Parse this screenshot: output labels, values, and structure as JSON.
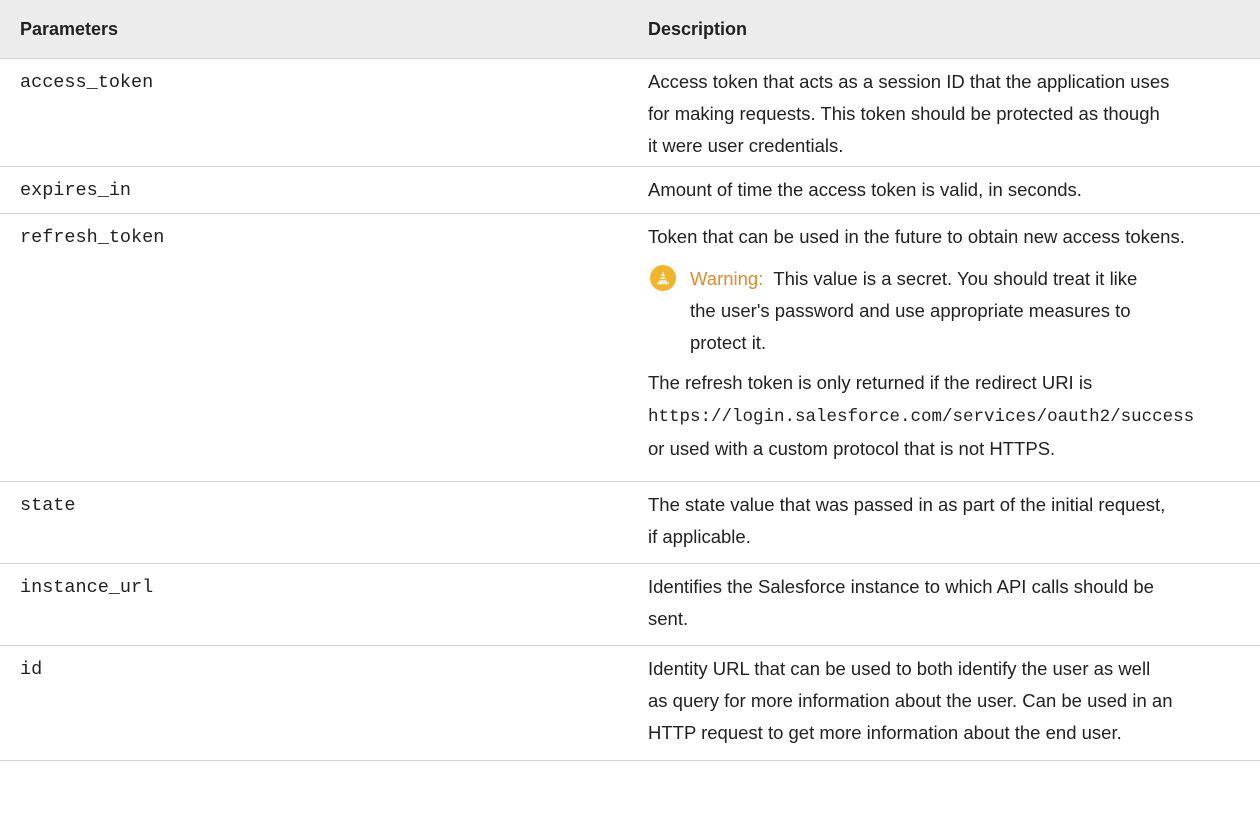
{
  "table": {
    "headers": {
      "parameters": "Parameters",
      "description": "Description"
    },
    "rows": [
      {
        "name": "access_token",
        "lines": [
          "Access token that acts as a session ID that the application uses",
          "for making requests. This token should be protected as though",
          "it were user credentials."
        ]
      },
      {
        "name": "expires_in",
        "lines": [
          "Amount of time the access token is valid, in seconds."
        ]
      },
      {
        "name": "refresh_token",
        "lines": [
          "Token that can be used in the future to obtain new access tokens."
        ],
        "warning": {
          "label": "Warning:",
          "line1": "This value is a secret. You should treat it like",
          "line2": "the user's password and use appropriate measures to",
          "line3": "protect it."
        },
        "after": {
          "line1": "The refresh token is only returned if the redirect URI is",
          "code": "https://login.salesforce.com/services/oauth2/success",
          "line3": "or used with a custom protocol that is not HTTPS."
        }
      },
      {
        "name": "state",
        "lines": [
          "The state value that was passed in as part of the initial request,",
          "if applicable."
        ]
      },
      {
        "name": "instance_url",
        "lines": [
          "Identifies the Salesforce instance to which API calls should be",
          "sent."
        ]
      },
      {
        "name": "id",
        "lines": [
          "Identity URL that can be used to both identify the user as well",
          "as query for more information about the user. Can be used in an",
          "HTTP request to get more information about the end user."
        ]
      }
    ]
  },
  "colors": {
    "header_bg": "#ececec",
    "row_border": "#d4d4d4",
    "warning_accent": "#e58a2b",
    "warning_icon_bg": "#f0b52a"
  }
}
